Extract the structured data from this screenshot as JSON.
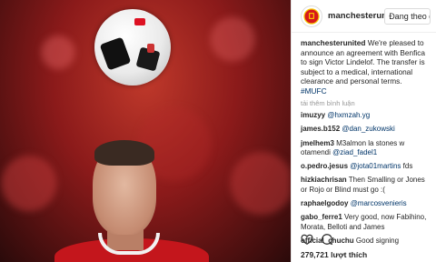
{
  "header": {
    "username": "manchesterunite",
    "follow_label": "Đang theo dõi"
  },
  "caption": {
    "username": "manchesterunited",
    "text": "We're pleased to announce an agreement with Benfica to sign Victor Lindelof. The transfer is subject to a medical, international clearance and personal terms.",
    "hashtag": "#MUFC"
  },
  "view_more_label": "tải thêm bình luận",
  "comments": [
    {
      "user": "imuzyy",
      "text": "",
      "mention": "@hxmzah.yg"
    },
    {
      "user": "james.b152",
      "text": "",
      "mention": "@dan_zukowski"
    },
    {
      "user": "jmelhem3",
      "text": "M3almon la stones w otamendi",
      "mention": "@ziad_fadel1"
    },
    {
      "user": "o.pedro.jesus",
      "text": "",
      "mention": "@jota01martins",
      "suffix": "fds"
    },
    {
      "user": "hizkiachrisan",
      "text": "Then Smalling or Jones or Rojo or Blind must go :(",
      "mention": ""
    },
    {
      "user": "raphaelgodoy",
      "text": "",
      "mention": "@marcosvenieris"
    },
    {
      "user": "gabo_ferre1",
      "text": "Very good, now Fabihino, Morata, Belloti and James",
      "mention": ""
    },
    {
      "user": "official_chuchu",
      "text": "Good signing",
      "mention": ""
    }
  ],
  "likes": "279,721 lượt thích",
  "icons": [
    "heart-icon",
    "comment-icon"
  ]
}
